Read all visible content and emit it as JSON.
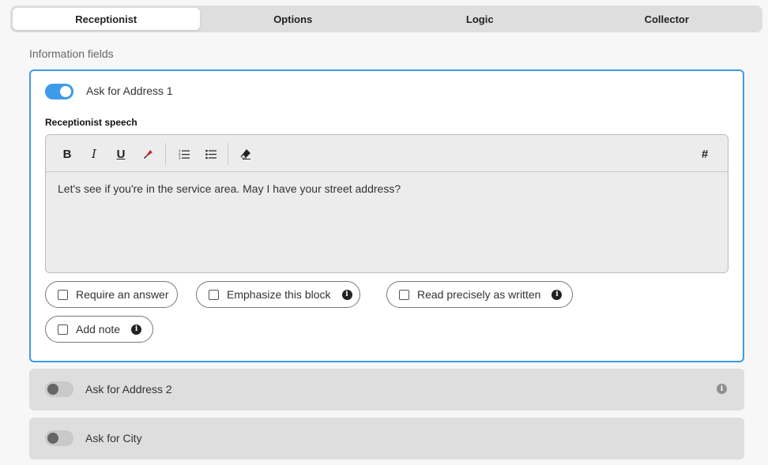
{
  "tabs": [
    {
      "label": "Receptionist",
      "active": true
    },
    {
      "label": "Options",
      "active": false
    },
    {
      "label": "Logic",
      "active": false
    },
    {
      "label": "Collector",
      "active": false
    }
  ],
  "section": {
    "title": "Information fields"
  },
  "field1": {
    "title": "Ask for Address 1",
    "enabled": true,
    "speech_label": "Receptionist speech",
    "speech_text": "Let's see if you're in the service area. May I have your street address?",
    "toolbar": {
      "bold": "B",
      "italic": "I",
      "underline": "U",
      "variable": "#"
    },
    "options": {
      "require_answer": "Require an answer",
      "emphasize": "Emphasize this block",
      "read_precisely": "Read precisely as written",
      "add_note": "Add note"
    }
  },
  "field2": {
    "title": "Ask for Address 2",
    "enabled": false
  },
  "field3": {
    "title": "Ask for City",
    "enabled": false
  },
  "colors": {
    "accent": "#3d9be9",
    "highlighter": "#c62828"
  },
  "icons": {
    "info": "info-icon",
    "highlighter": "highlighter-icon",
    "ordered_list": "ordered-list-icon",
    "bullet_list": "bullet-list-icon",
    "eraser": "eraser-icon"
  }
}
